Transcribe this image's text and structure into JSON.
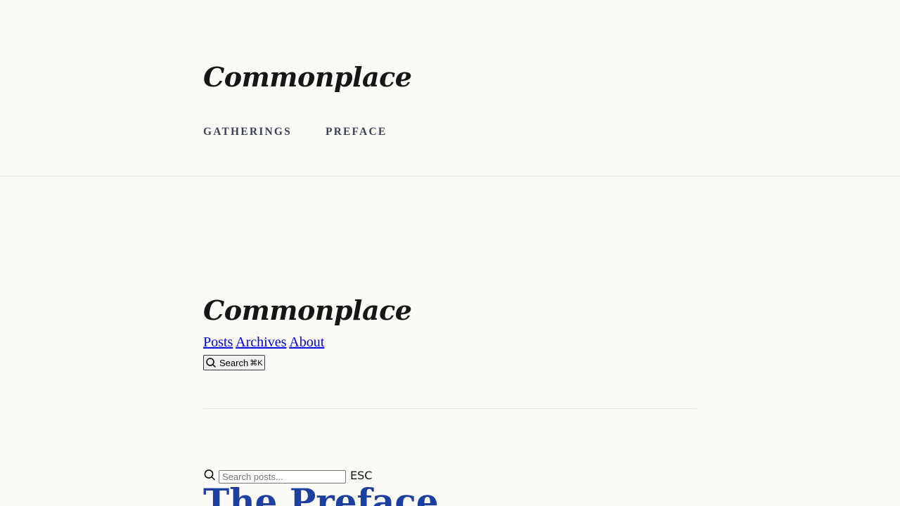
{
  "site": {
    "title": "Commonplace"
  },
  "top_nav": {
    "items": [
      {
        "label": "GATHERINGS"
      },
      {
        "label": "PREFACE"
      }
    ]
  },
  "secondary_header": {
    "title": "Commonplace",
    "links": [
      {
        "label": "Posts"
      },
      {
        "label": "Archives"
      },
      {
        "label": "About"
      }
    ],
    "search_button": {
      "label": "Search",
      "shortcut": "⌘K",
      "icon": "search-icon"
    }
  },
  "search": {
    "placeholder": "Search posts...",
    "value": "",
    "close_label": "ESC",
    "icon": "search-icon"
  },
  "post": {
    "title": "The Preface"
  },
  "colors": {
    "background": "#fbfaf7",
    "link": "#0000ee",
    "post_title": "#1d3fa0",
    "nav_text": "#3a4150"
  }
}
